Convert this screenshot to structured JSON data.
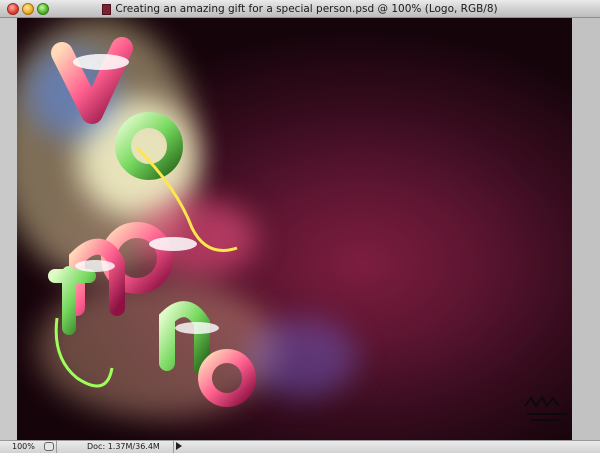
{
  "window": {
    "title": "Creating an amazing gift for a special person.psd @ 100% (Logo, RGB/8)"
  },
  "canvas": {
    "artwork_letters": [
      "V",
      "a",
      "l",
      "e",
      "n",
      "t",
      "i",
      "n",
      "e"
    ],
    "signature_mark": "handwritten signature"
  },
  "statusbar": {
    "zoom": "100%",
    "doc_info": "Doc: 1.37M/36.4M"
  },
  "icons": {
    "close": "close-icon",
    "minimize": "minimize-icon",
    "zoom": "zoom-icon",
    "document": "psd-document-icon",
    "status": "status-icon",
    "menu": "play-arrow-icon"
  },
  "colors": {
    "canvas_bg": "#5c1530",
    "glow_yellow": "#ffe97a",
    "glow_pink": "#ff5c9a",
    "glow_green": "#8cff6b"
  }
}
